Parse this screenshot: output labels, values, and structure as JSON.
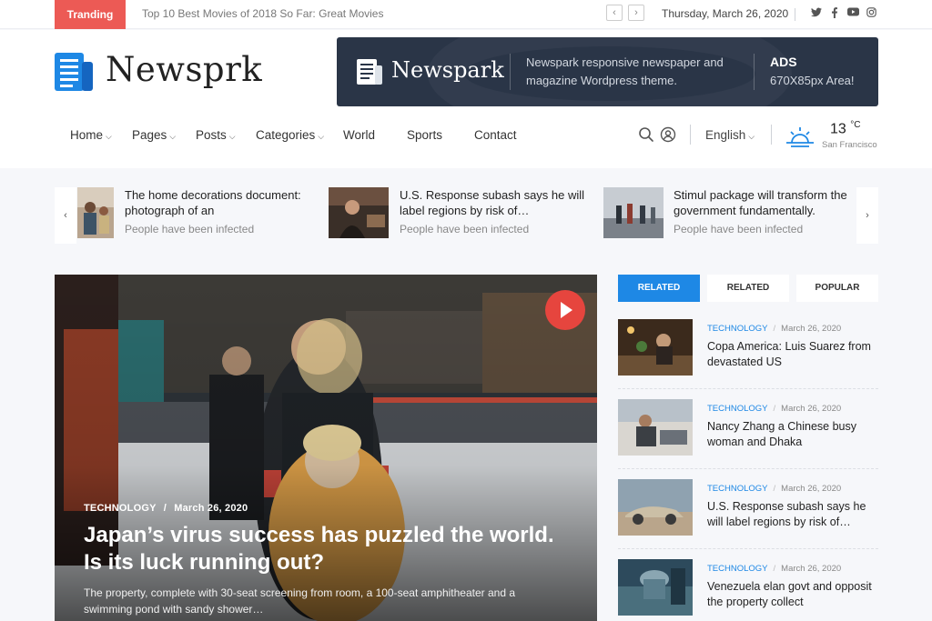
{
  "topbar": {
    "trending_label": "Tranding",
    "ticker_text": "Top 10 Best Movies of 2018 So Far: Great Movies",
    "prev_label": "‹",
    "next_label": "›",
    "date": "Thursday, March 26, 2020",
    "social_icons": [
      "twitter-icon",
      "facebook-icon",
      "youtube-icon",
      "instagram-icon"
    ]
  },
  "header": {
    "logo_text": "Newsprk",
    "ad": {
      "logo_text": "Newspark",
      "description": "Newspark responsive newspaper and magazine Wordpress theme.",
      "label": "ADS",
      "size": "670X85px Area!"
    }
  },
  "nav": {
    "items": [
      {
        "label": "Home",
        "dropdown": true
      },
      {
        "label": "Pages",
        "dropdown": true
      },
      {
        "label": "Posts",
        "dropdown": true
      },
      {
        "label": "Categories",
        "dropdown": true
      },
      {
        "label": "World",
        "dropdown": false
      },
      {
        "label": "Sports",
        "dropdown": false
      },
      {
        "label": "Contact",
        "dropdown": false
      }
    ],
    "language": "English",
    "weather": {
      "temp": "13",
      "unit": "°C",
      "city": "San Francisco"
    }
  },
  "carousel": {
    "items": [
      {
        "title": "The home decorations document: photograph of an",
        "subtitle": "People have been infected"
      },
      {
        "title": "U.S. Response subash says he will label regions by risk of…",
        "subtitle": "People have been infected"
      },
      {
        "title": "Stimul package will transform the government fundamentally.",
        "subtitle": "People have been infected"
      }
    ]
  },
  "hero": {
    "category": "TECHNOLOGY",
    "date": "March 26, 2020",
    "title": "Japan’s virus success has puzzled the world. Is its luck running out?",
    "excerpt": "The property, complete with 30-seat screening from room, a 100-seat amphitheater and a swimming pond with sandy shower…"
  },
  "sidebar": {
    "tabs": [
      "RELATED",
      "RELATED",
      "POPULAR"
    ],
    "active_tab": 0,
    "posts": [
      {
        "category": "TECHNOLOGY",
        "date": "March 26, 2020",
        "title": "Copa America: Luis Suarez from devastated US"
      },
      {
        "category": "TECHNOLOGY",
        "date": "March 26, 2020",
        "title": "Nancy Zhang a Chinese busy woman and Dhaka"
      },
      {
        "category": "TECHNOLOGY",
        "date": "March 26, 2020",
        "title": "U.S. Response subash says he will label regions by risk of…"
      },
      {
        "category": "TECHNOLOGY",
        "date": "March 26, 2020",
        "title": "Venezuela elan govt and opposit the property collect"
      }
    ]
  },
  "colors": {
    "accent_red": "#ec5a55",
    "accent_blue": "#1e88e5",
    "ad_bg": "#2a3547"
  }
}
